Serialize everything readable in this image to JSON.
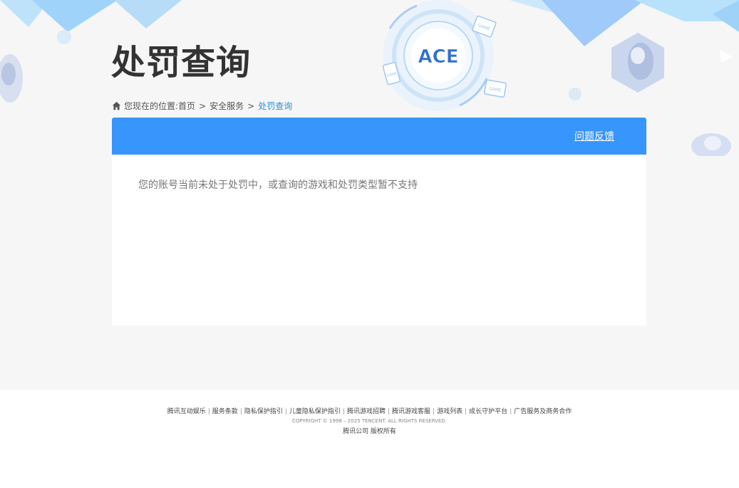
{
  "page_title": "处罚查询",
  "breadcrumb": {
    "prefix": "您现在的位置:",
    "items": [
      "首页",
      "安全服务"
    ],
    "separator": ">",
    "current": "处罚查询"
  },
  "panel": {
    "feedback_label": "问题反馈",
    "message": "您的账号当前未处于处罚中，或查询的游戏和处罚类型暂不支持"
  },
  "logo_text": "ACE",
  "badge_text": "GAME",
  "footer": {
    "links": [
      "腾讯互动娱乐",
      "服务条款",
      "隐私保护指引",
      "儿童隐私保护指引",
      "腾讯游戏招聘",
      "腾讯游戏客服",
      "游戏列表",
      "成长守护平台",
      "广告服务及商务合作"
    ],
    "link_separator": "|",
    "copyright": "COPYRIGHT © 1998 – 2025 TENCENT. ALL RIGHTS RESERVED.",
    "company": "腾讯公司 版权所有"
  },
  "colors": {
    "accent": "#3795fb",
    "breadcrumb_current": "#2a8fd8",
    "title": "#333333",
    "page_bg": "#f6f6f6"
  }
}
